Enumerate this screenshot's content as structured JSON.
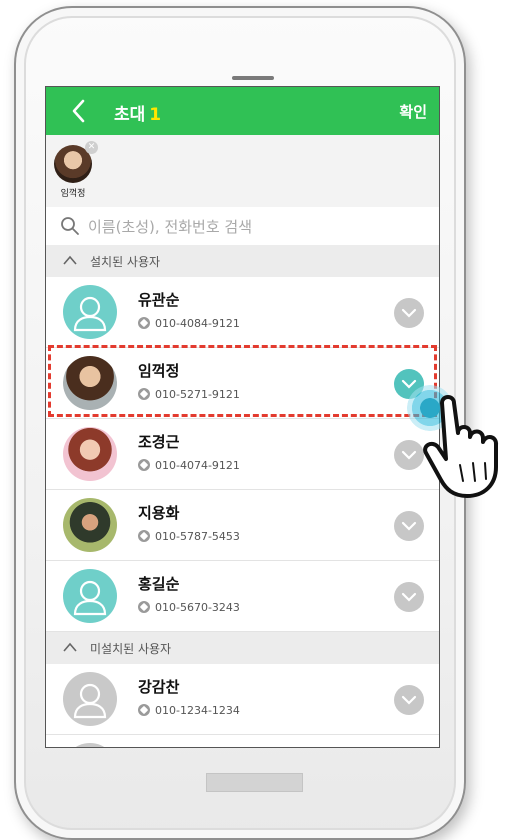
{
  "header": {
    "title": "초대",
    "count": "1",
    "confirm_label": "확인"
  },
  "selected": [
    {
      "name": "임꺽정"
    }
  ],
  "search": {
    "placeholder": "이름(초성), 전화번호 검색"
  },
  "sections": {
    "installed": "설치된 사용자",
    "not_installed": "미설치된 사용자"
  },
  "installed_contacts": [
    {
      "name": "유관순",
      "phone": "010-4084-9121",
      "avatar": "default-person",
      "checked": false
    },
    {
      "name": "임꺽정",
      "phone": "010-5271-9121",
      "avatar": "photo",
      "checked": true
    },
    {
      "name": "조경근",
      "phone": "010-4074-9121",
      "avatar": "photo",
      "checked": false
    },
    {
      "name": "지용화",
      "phone": "010-5787-5453",
      "avatar": "photo",
      "checked": false
    },
    {
      "name": "홍길순",
      "phone": "010-5670-3243",
      "avatar": "default-person",
      "checked": false
    }
  ],
  "not_installed_contacts": [
    {
      "name": "강감찬",
      "phone": "010-1234-1234",
      "avatar": "default-person-gray",
      "checked": false
    }
  ],
  "colors": {
    "accent": "#30c155",
    "count": "#ffe600",
    "check_on": "#52c3bd",
    "check_off": "#c7c7c7",
    "highlight": "#e33b2f"
  }
}
